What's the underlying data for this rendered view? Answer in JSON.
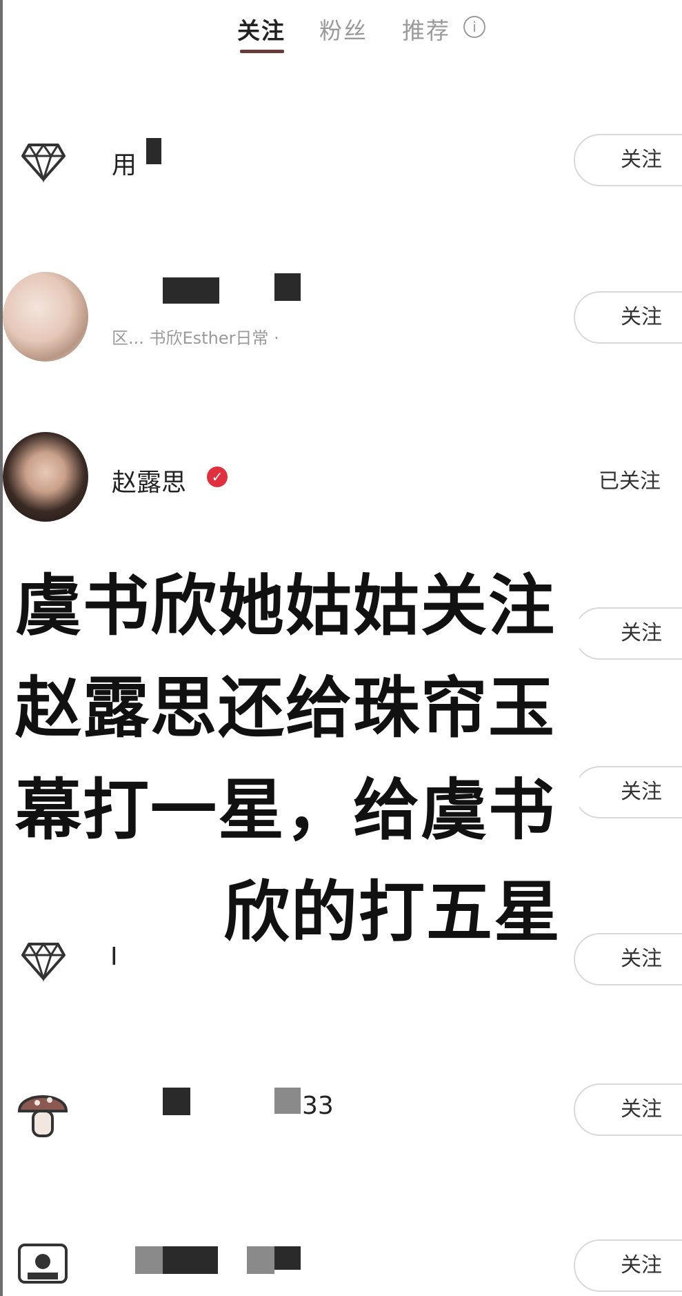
{
  "tabs": [
    {
      "label": "关注",
      "active": true
    },
    {
      "label": "粉丝",
      "active": false
    },
    {
      "label": "推荐",
      "active": false
    }
  ],
  "info_icon": "info-icon",
  "rows": [
    {
      "icon": "diamond-icon",
      "name": "用",
      "button": "关注"
    },
    {
      "icon": "avatar-photo",
      "subtitle": "区... 书欣Esther日常 ·",
      "button": "关注"
    },
    {
      "icon": "avatar-photo",
      "name": "赵露思",
      "verified": true,
      "button": "已关注"
    },
    {
      "button": "关注"
    },
    {
      "button": "关注"
    },
    {
      "icon": "diamond-icon",
      "name": "I",
      "button": "关注"
    },
    {
      "icon": "mushroom-icon",
      "name": "33",
      "button": "关注"
    },
    {
      "icon": "camera-icon",
      "button": "关注"
    }
  ],
  "caption": {
    "line1": "虞书欣她姑姑关注",
    "line2": "赵露思还给珠帘玉",
    "line3": "幕打一星，给虞书",
    "line4": "欣的打五星"
  },
  "colors": {
    "accent_underline": "#6b3a3a",
    "verified_badge": "#e0303f",
    "button_border": "#d8d8d8"
  }
}
